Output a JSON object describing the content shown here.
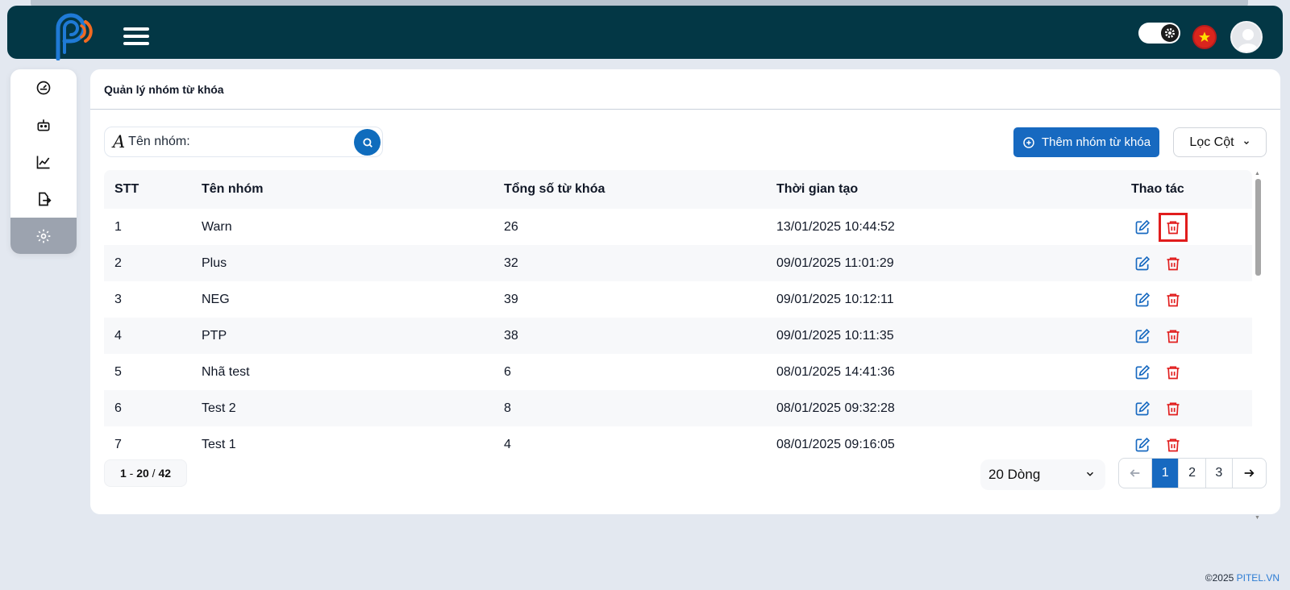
{
  "page": {
    "title": "Quản lý nhóm từ khóa"
  },
  "search": {
    "placeholder": "Tên nhóm:"
  },
  "toolbar": {
    "add_label": "Thêm nhóm từ khóa",
    "filter_label": "Lọc Cột"
  },
  "table": {
    "headers": [
      "STT",
      "Tên nhóm",
      "Tổng số từ khóa",
      "Thời gian tạo",
      "Thao tác"
    ],
    "rows": [
      {
        "stt": "1",
        "name": "Warn",
        "count": "26",
        "created": "13/01/2025 10:44:52"
      },
      {
        "stt": "2",
        "name": "Plus",
        "count": "32",
        "created": "09/01/2025 11:01:29"
      },
      {
        "stt": "3",
        "name": "NEG",
        "count": "39",
        "created": "09/01/2025 10:12:11"
      },
      {
        "stt": "4",
        "name": "PTP",
        "count": "38",
        "created": "09/01/2025 10:11:35"
      },
      {
        "stt": "5",
        "name": "Nhã test",
        "count": "6",
        "created": "08/01/2025 14:41:36"
      },
      {
        "stt": "6",
        "name": "Test 2",
        "count": "8",
        "created": "08/01/2025 09:32:28"
      },
      {
        "stt": "7",
        "name": "Test 1",
        "count": "4",
        "created": "08/01/2025 09:16:05"
      }
    ]
  },
  "pagination": {
    "range_start": "1",
    "range_sep": "-",
    "range_end": "20",
    "range_slash": "/",
    "total": "42",
    "rows_per_page": "20 Dòng",
    "pages": [
      "1",
      "2",
      "3"
    ],
    "current_page": "1"
  },
  "footer": {
    "copyright": "©2025",
    "brand": "PITEL.VN"
  },
  "colors": {
    "topbar": "#033745",
    "primary": "#1769c0",
    "danger": "#e11d1d",
    "logo_blue": "#1f7ad6",
    "logo_orange": "#f26a21"
  },
  "icons": [
    "menu-icon",
    "settings-icon",
    "vn-flag-icon",
    "avatar-icon",
    "dashboard-icon",
    "robot-icon",
    "chart-icon",
    "export-icon",
    "gear-icon",
    "font-icon",
    "search-icon",
    "plus-circle-icon",
    "chevron-down-icon",
    "edit-icon",
    "trash-icon",
    "arrow-left-icon",
    "arrow-right-icon"
  ]
}
